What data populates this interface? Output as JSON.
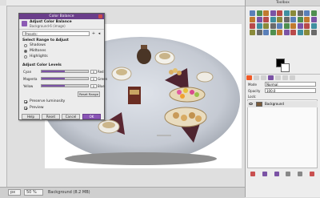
{
  "status_bar": {
    "unit": "px",
    "zoom": "50 %",
    "message": "Background (8.2 MB)"
  },
  "color_balance_dialog": {
    "window_title": "Color Balance",
    "header_title": "Adjust Color Balance",
    "header_subtitle": "Background-6 (image)",
    "presets_label": "Presets:",
    "section_range": "Select Range to Adjust",
    "ranges": [
      "Shadows",
      "Midtones",
      "Highlights"
    ],
    "selected_range": "Midtones",
    "section_levels": "Adjust Color Levels",
    "sliders": [
      {
        "left": "Cyan",
        "right": "Red",
        "value": "0"
      },
      {
        "left": "Magenta",
        "right": "Green",
        "value": "0"
      },
      {
        "left": "Yellow",
        "right": "Blue",
        "value": "0"
      }
    ],
    "reset_range_label": "Reset Range",
    "preserve_luminosity_label": "Preserve luminosity",
    "preview_label": "Preview",
    "buttons": {
      "help": "Help",
      "reset": "Reset",
      "cancel": "Cancel",
      "ok": "OK"
    }
  },
  "toolbox": {
    "title": "Toolbox",
    "fg_color": "#000000",
    "bg_color": "#ffffff",
    "tool_icon_names": [
      "rect-select-icon",
      "ellipse-select-icon",
      "free-select-icon",
      "fuzzy-select-icon",
      "color-select-icon",
      "scissors-icon",
      "foreground-select-icon",
      "paths-icon",
      "color-picker-icon",
      "zoom-icon",
      "measure-icon",
      "move-icon",
      "align-icon",
      "crop-icon",
      "rotate-icon",
      "scale-icon",
      "shear-icon",
      "perspective-icon",
      "flip-icon",
      "cage-icon",
      "text-icon",
      "bucket-fill-icon",
      "blend-icon",
      "pencil-icon",
      "paintbrush-icon",
      "eraser-icon",
      "airbrush-icon",
      "ink-icon",
      "clone-icon",
      "heal-icon",
      "perspective-clone-icon",
      "blur-icon",
      "smudge-icon",
      "dodge-burn-icon",
      "warp-icon",
      "unified-transform-icon",
      "handle-transform-icon",
      "mypaint-brush-icon",
      "sample-icon",
      "gradient-icon"
    ]
  },
  "layers_panel": {
    "mode_label": "Mode",
    "mode_value": "Normal",
    "opacity_label": "Opacity",
    "opacity_value": "100.0",
    "lock_label": "Lock:",
    "layer_name": "Background"
  }
}
